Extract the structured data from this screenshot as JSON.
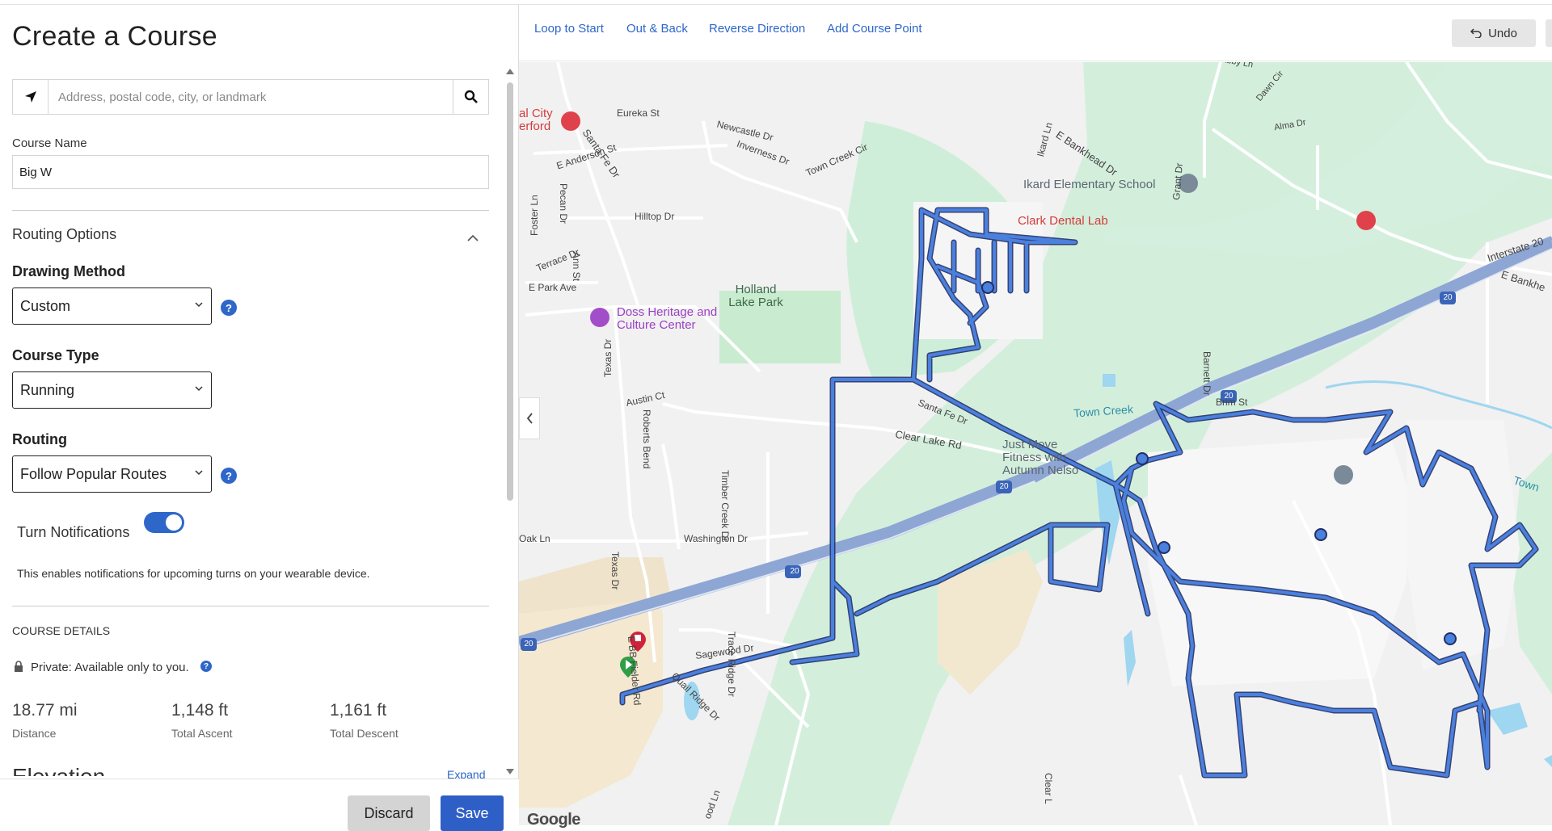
{
  "title": "Create a Course",
  "search": {
    "placeholder": "Address, postal code, city, or landmark",
    "value": ""
  },
  "course_name": {
    "label": "Course Name",
    "value": "Big W"
  },
  "routing_options": {
    "heading": "Routing Options",
    "drawing_method": {
      "label": "Drawing Method",
      "value": "Custom"
    },
    "course_type": {
      "label": "Course Type",
      "value": "Running"
    },
    "routing": {
      "label": "Routing",
      "value": "Follow Popular Routes"
    },
    "turn_notifications": {
      "label": "Turn Notifications",
      "enabled": true,
      "description": "This enables notifications for upcoming turns on your wearable device."
    }
  },
  "course_details": {
    "heading": "COURSE DETAILS",
    "privacy": "Private: Available only to you.",
    "distance": {
      "value": "18.77 mi",
      "label": "Distance"
    },
    "ascent": {
      "value": "1,148 ft",
      "label": "Total Ascent"
    },
    "descent": {
      "value": "1,161 ft",
      "label": "Total Descent"
    },
    "elevation": {
      "heading": "Elevation",
      "expand": "Expand"
    }
  },
  "footer": {
    "discard": "Discard",
    "save": "Save"
  },
  "toolbar": {
    "loop_to_start": "Loop to Start",
    "out_and_back": "Out & Back",
    "reverse_direction": "Reverse Direction",
    "add_course_point": "Add Course Point",
    "undo": "Undo"
  },
  "map": {
    "labels": {
      "hospital": "al City erford",
      "eureka": "Eureka St",
      "santa_fe": "Santa Fe Dr",
      "newcastle": "Newcastle Dr",
      "inverness": "Inverness Dr",
      "town_creek_cir": "Town Creek Cir",
      "anderson": "E Anderson St",
      "pecan": "Pecan Dr",
      "foster": "Foster Ln",
      "hilltop": "Hilltop Dr",
      "terrace": "Terrace Dr",
      "ann": "Ann St",
      "park_ave": "E Park Ave",
      "holland": "Holland Lake Park",
      "doss": "Doss Heritage and Culture Center",
      "texas_dr": "Texas Dr",
      "austin": "Austin Ct",
      "roberts": "Roberts Bend",
      "santa_fe2": "Santa Fe Dr",
      "clear_lake": "Clear Lake Rd",
      "timber": "Timber Creek Dr",
      "oak": "Oak Ln",
      "washington": "Washington Dr",
      "texas_dr2": "Texas Dr",
      "eb_fielder": "E BB Fielder Rd",
      "sagewood": "Sagewood Dr",
      "quail": "Quail Ridge Dr",
      "trace": "Trace Ridge Dr",
      "ikard_ln": "Ikard Ln",
      "bankhead": "E Bankhead Dr",
      "ikard_school": "Ikard Elementary School",
      "abbey": "Abby Ln",
      "dawn": "Dawn Cir",
      "alma": "Alma Dr",
      "grant": "Grant Dr",
      "clark": "Clark Dental Lab",
      "interstate": "Interstate 20",
      "bankhead2": "E Bankhe",
      "town_creek": "Town Creek",
      "barnett": "Barnett Dr",
      "brim": "Brim St",
      "just_move": "Just Move Fitness with Autumn Nelso",
      "town2": "Town",
      "clear_ln": "Clear L",
      "wood_ln": "ood Ln",
      "i20a": "20",
      "i20b": "20",
      "i20c": "20",
      "i20d": "20",
      "i20e": "20"
    },
    "google": "Google"
  },
  "colors": {
    "accent": "#2e67c9",
    "route": "#3f76d6",
    "park": "#cfeed9",
    "water": "#9fd6f0"
  }
}
